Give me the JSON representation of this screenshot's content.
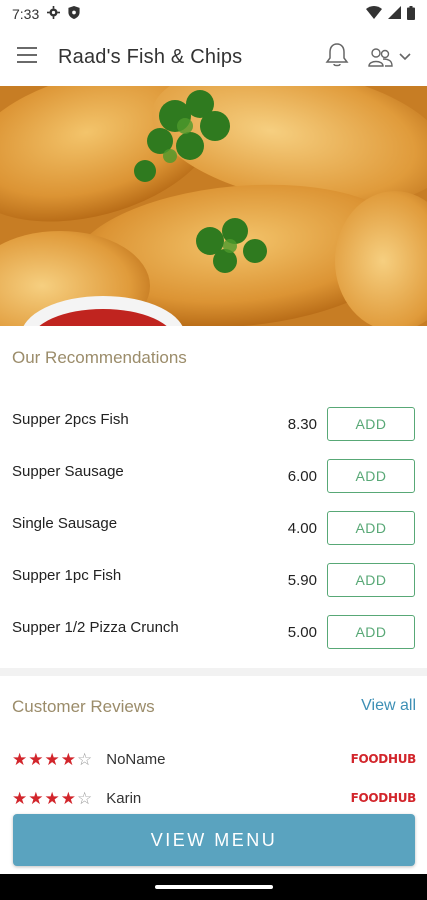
{
  "status_bar": {
    "time": "7:33",
    "icons": [
      "gear-icon",
      "shield-icon",
      "wifi-icon",
      "signal-icon",
      "battery-icon"
    ]
  },
  "app_bar": {
    "title": "Raad's Fish & Chips",
    "icons": [
      "menu-icon",
      "bell-icon",
      "user-group-icon",
      "chevron-down-icon"
    ]
  },
  "hero": {
    "description_icon": "fish-and-chips-photo"
  },
  "recommendations": {
    "title": "Our Recommendations",
    "add_label": "ADD",
    "items": [
      {
        "name": "Supper 2pcs Fish",
        "price": "8.30"
      },
      {
        "name": "Supper Sausage",
        "price": "6.00"
      },
      {
        "name": "Single Sausage",
        "price": "4.00"
      },
      {
        "name": "Supper 1pc Fish",
        "price": "5.90"
      },
      {
        "name": "Supper 1/2 Pizza Crunch",
        "price": "5.00"
      }
    ]
  },
  "reviews": {
    "title": "Customer Reviews",
    "view_all": "View all",
    "items": [
      {
        "name": "NoName",
        "rating": 4,
        "max_rating": 5,
        "source": "FOODHUB"
      },
      {
        "name": "Karin",
        "rating": 4,
        "max_rating": 5,
        "source": "FOODHUB"
      }
    ]
  },
  "cta": {
    "label": "VIEW MENU"
  },
  "colors": {
    "accent_green": "#58a876",
    "accent_blue": "#5aa3bf",
    "link_blue": "#3d8fb5",
    "star_red": "#d2252b",
    "section_title": "#9b8c6a"
  }
}
